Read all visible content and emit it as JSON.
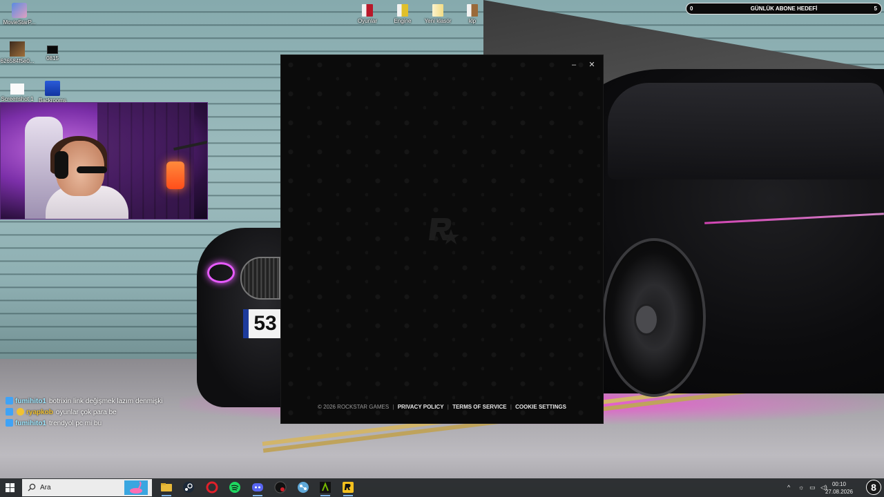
{
  "desktop": {
    "icons": [
      {
        "label": "MovieStarP...",
        "icon": "moviestar-app-icon"
      },
      {
        "label": "626584f5e0...",
        "icon": "image-file-icon"
      },
      {
        "label": "0815",
        "icon": "black-image-file-icon"
      },
      {
        "label": "Screenshot 1",
        "icon": "screenshot-file-icon"
      },
      {
        "label": "Backrooms",
        "icon": "backrooms-game-icon"
      },
      {
        "label": "Oyunlar",
        "icon": "folder-icon"
      },
      {
        "label": "Engine",
        "icon": "folder-icon"
      },
      {
        "label": "Yeni klasör",
        "icon": "folder-icon"
      },
      {
        "label": "klp",
        "icon": "folder-icon"
      }
    ],
    "wallpaper_plate": "53"
  },
  "goal": {
    "min": "0",
    "title": "GÜNLÜK ABONE HEDEFİ",
    "max": "5"
  },
  "chat": [
    {
      "user": "fumihito1",
      "message": "botrixin link değişmek lazım denmişki",
      "user_color": "#9fe8ff"
    },
    {
      "user": "ryapkob",
      "message": "oyunlar çok para be",
      "user_color": "#f1c232"
    },
    {
      "user": "fumihito1",
      "message": "trendyol pc mi bu",
      "user_color": "#9fe8ff"
    }
  ],
  "launcher": {
    "minimize_glyph": "–",
    "close_glyph": "✕",
    "copyright": "© 2026 ROCKSTAR GAMES",
    "links": [
      "PRIVACY POLICY",
      "TERMS OF SERVICE",
      "COOKIE SETTINGS"
    ],
    "separator": "|"
  },
  "taskbar": {
    "search_placeholder": "Ara",
    "apps": [
      {
        "name": "file-explorer",
        "color": "#e8b93a"
      },
      {
        "name": "steam",
        "color": "#1b2838"
      },
      {
        "name": "opera",
        "color": "#e0202a"
      },
      {
        "name": "spotify",
        "color": "#1ed760"
      },
      {
        "name": "discord",
        "color": "#5865f2"
      },
      {
        "name": "record-app",
        "color": "#d0202a"
      },
      {
        "name": "network-app",
        "color": "#5fa8d8"
      },
      {
        "name": "nvidia-app",
        "color": "#76b900"
      },
      {
        "name": "rockstar-launcher",
        "color": "#f4c01e"
      }
    ],
    "time": "00:10",
    "date": "27.08.2026",
    "notification_count": "8"
  }
}
